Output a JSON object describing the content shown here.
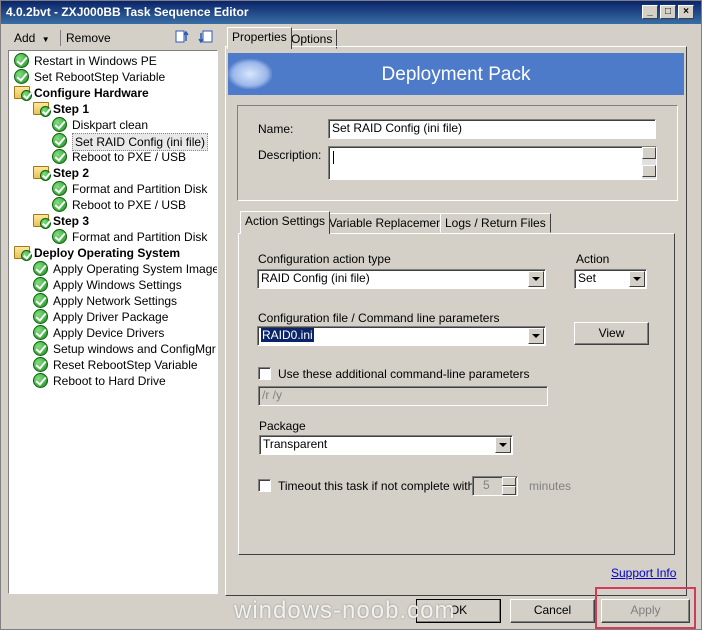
{
  "window": {
    "title": "4.0.2bvt - ZXJ000BB Task Sequence Editor",
    "controls": [
      "_",
      "□",
      "×"
    ]
  },
  "left_toolbar": {
    "add": "Add",
    "remove": "Remove"
  },
  "tree": [
    {
      "label": "Restart in Windows PE",
      "type": "step"
    },
    {
      "label": "Set RebootStep Variable",
      "type": "step"
    },
    {
      "label": "Configure Hardware",
      "type": "group"
    },
    {
      "label": "Step 1",
      "type": "group"
    },
    {
      "label": "Diskpart clean",
      "type": "step"
    },
    {
      "label": "Set RAID Config (ini file)",
      "type": "step",
      "selected": true
    },
    {
      "label": "Reboot to PXE / USB",
      "type": "step"
    },
    {
      "label": "Step 2",
      "type": "group"
    },
    {
      "label": "Format and Partition Disk",
      "type": "step"
    },
    {
      "label": "Reboot to PXE / USB",
      "type": "step"
    },
    {
      "label": "Step 3",
      "type": "group"
    },
    {
      "label": "Format and Partition Disk",
      "type": "step"
    },
    {
      "label": "Deploy Operating System",
      "type": "group"
    },
    {
      "label": "Apply Operating System Image",
      "type": "step"
    },
    {
      "label": "Apply Windows Settings",
      "type": "step"
    },
    {
      "label": "Apply Network Settings",
      "type": "step"
    },
    {
      "label": "Apply Driver Package",
      "type": "step"
    },
    {
      "label": "Apply Device Drivers",
      "type": "step"
    },
    {
      "label": "Setup windows and ConfigMgr",
      "type": "step"
    },
    {
      "label": "Reset RebootStep Variable",
      "type": "step"
    },
    {
      "label": "Reboot to Hard Drive",
      "type": "step"
    }
  ],
  "tabs": {
    "properties": "Properties",
    "options": "Options"
  },
  "banner": {
    "title": "Deployment Pack"
  },
  "form": {
    "name_label": "Name:",
    "name_value": "Set RAID Config (ini file)",
    "description_label": "Description:",
    "description_value": ""
  },
  "subtabs": {
    "action_settings": "Action Settings",
    "variable_replacement": "Variable Replacement",
    "logs": "Logs / Return Files"
  },
  "action": {
    "config_type_label": "Configuration action type",
    "config_type_value": "RAID Config (ini file)",
    "action_label": "Action",
    "action_value": "Set",
    "config_file_label": "Configuration file / Command line parameters",
    "config_file_value": "RAID0.ini",
    "view_button": "View",
    "additional_params_label": "Use these additional command-line parameters",
    "additional_params_value": "/r /y",
    "package_label": "Package",
    "package_value": "Transparent",
    "timeout_label": "Timeout this task if not complete within",
    "timeout_value": "5",
    "timeout_unit": "minutes"
  },
  "support_link": "Support Info",
  "buttons": {
    "ok": "OK",
    "cancel": "Cancel",
    "apply": "Apply"
  },
  "watermark": "windows-noob.com"
}
